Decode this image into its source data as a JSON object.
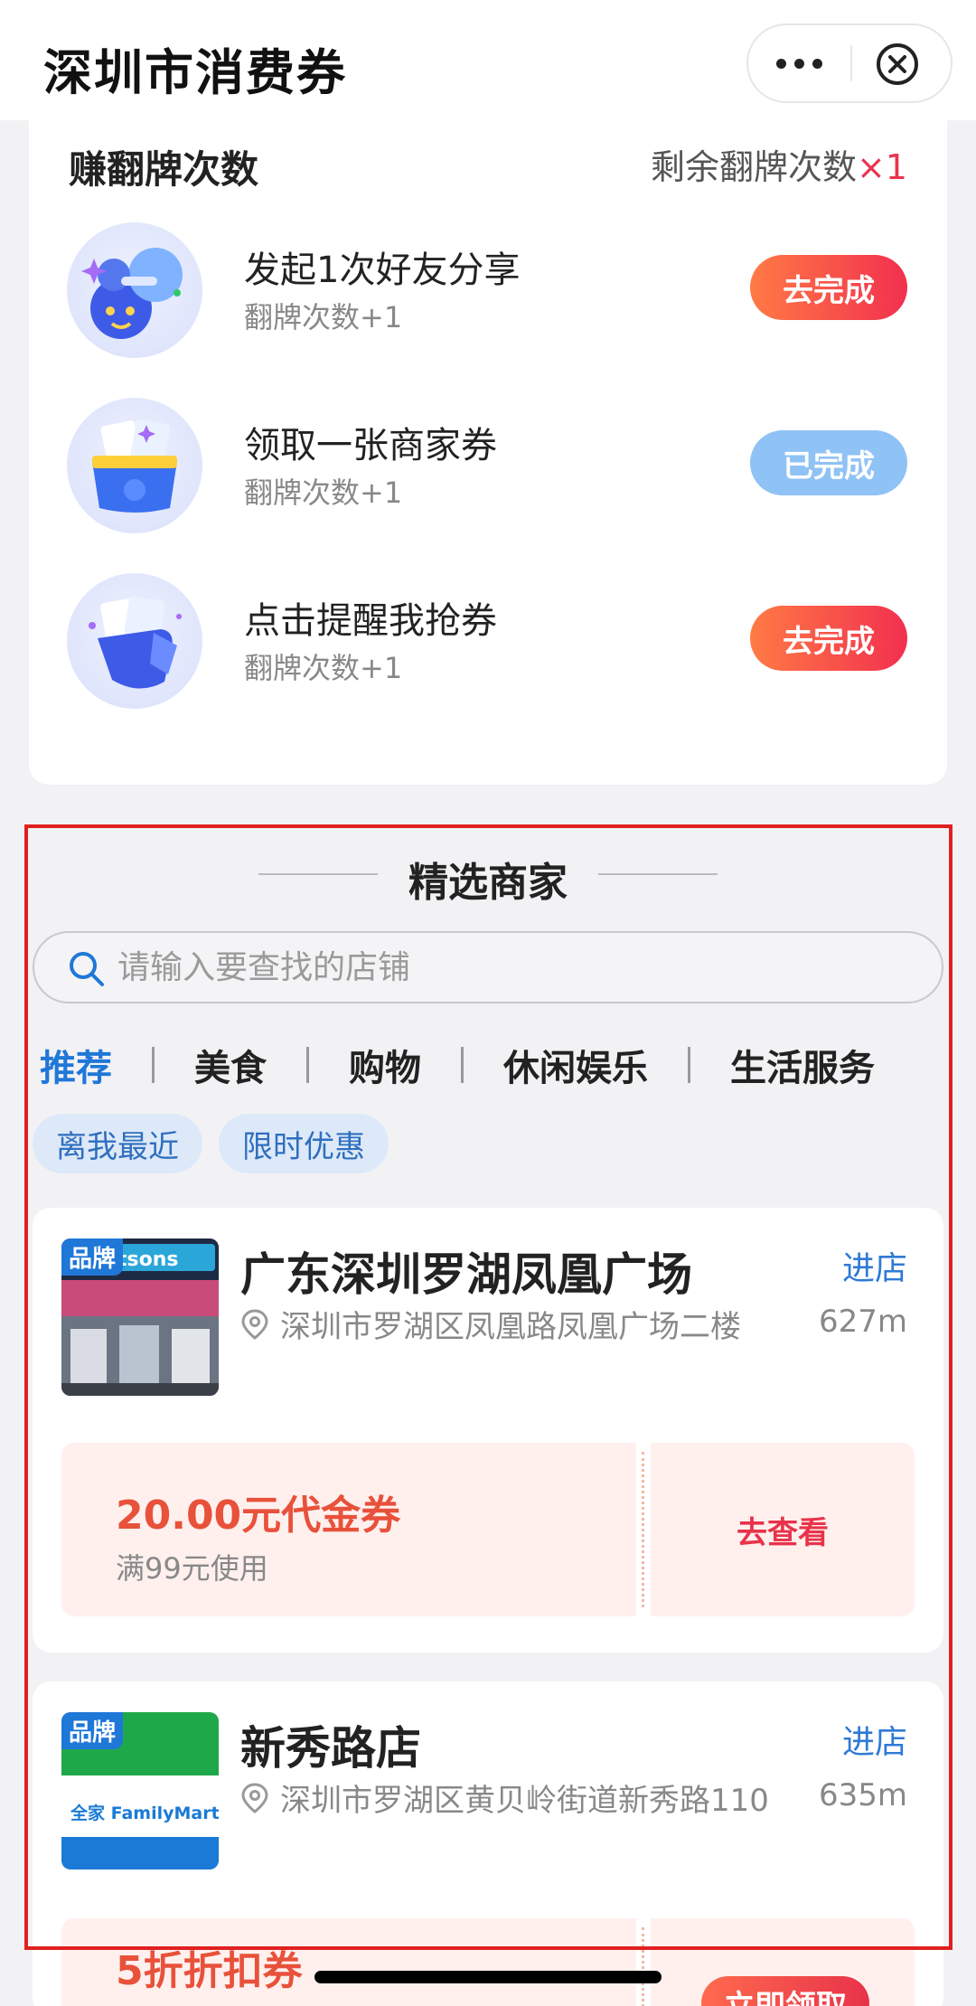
{
  "header": {
    "title": "深圳市消费券"
  },
  "tasks_card": {
    "title": "赚翻牌次数",
    "remaining_label": "剩余翻牌次数",
    "remaining_count": "×1",
    "tasks": [
      {
        "name": "发起1次好友分享",
        "reward": "翻牌次数+1",
        "button": "去完成",
        "state": "todo"
      },
      {
        "name": "领取一张商家券",
        "reward": "翻牌次数+1",
        "button": "已完成",
        "state": "done"
      },
      {
        "name": "点击提醒我抢券",
        "reward": "翻牌次数+1",
        "button": "去完成",
        "state": "todo"
      }
    ]
  },
  "merchants": {
    "section_title": "精选商家",
    "search": {
      "placeholder": "请输入要查找的店铺"
    },
    "tabs": [
      "推荐",
      "美食",
      "购物",
      "休闲娱乐",
      "生活服务"
    ],
    "filters": [
      "离我最近",
      "限时优惠"
    ],
    "stores": [
      {
        "tag": "品牌",
        "logo_text": "tsons",
        "name": "广东深圳罗湖凤凰广场",
        "enter": "进店",
        "address": "深圳市罗湖区凤凰路凤凰广场二楼",
        "distance": "627m",
        "coupon": {
          "amount": "20.00元代金券",
          "condition": "满99元使用",
          "action": "去查看"
        }
      },
      {
        "tag": "品牌",
        "logo_text": "全家 FamilyMart",
        "name": "新秀路店",
        "enter": "进店",
        "address": "深圳市罗湖区黄贝岭街道新秀路110",
        "distance": "635m",
        "coupon": {
          "amount": "5折折扣券",
          "condition": "",
          "action": "立即领取"
        }
      }
    ]
  },
  "colors": {
    "accent_blue": "#1f77d8",
    "todo_button": "#f2304f",
    "done_button": "#8fc2f5",
    "coupon_red": "#e8513a",
    "frame_red": "#e02020"
  }
}
